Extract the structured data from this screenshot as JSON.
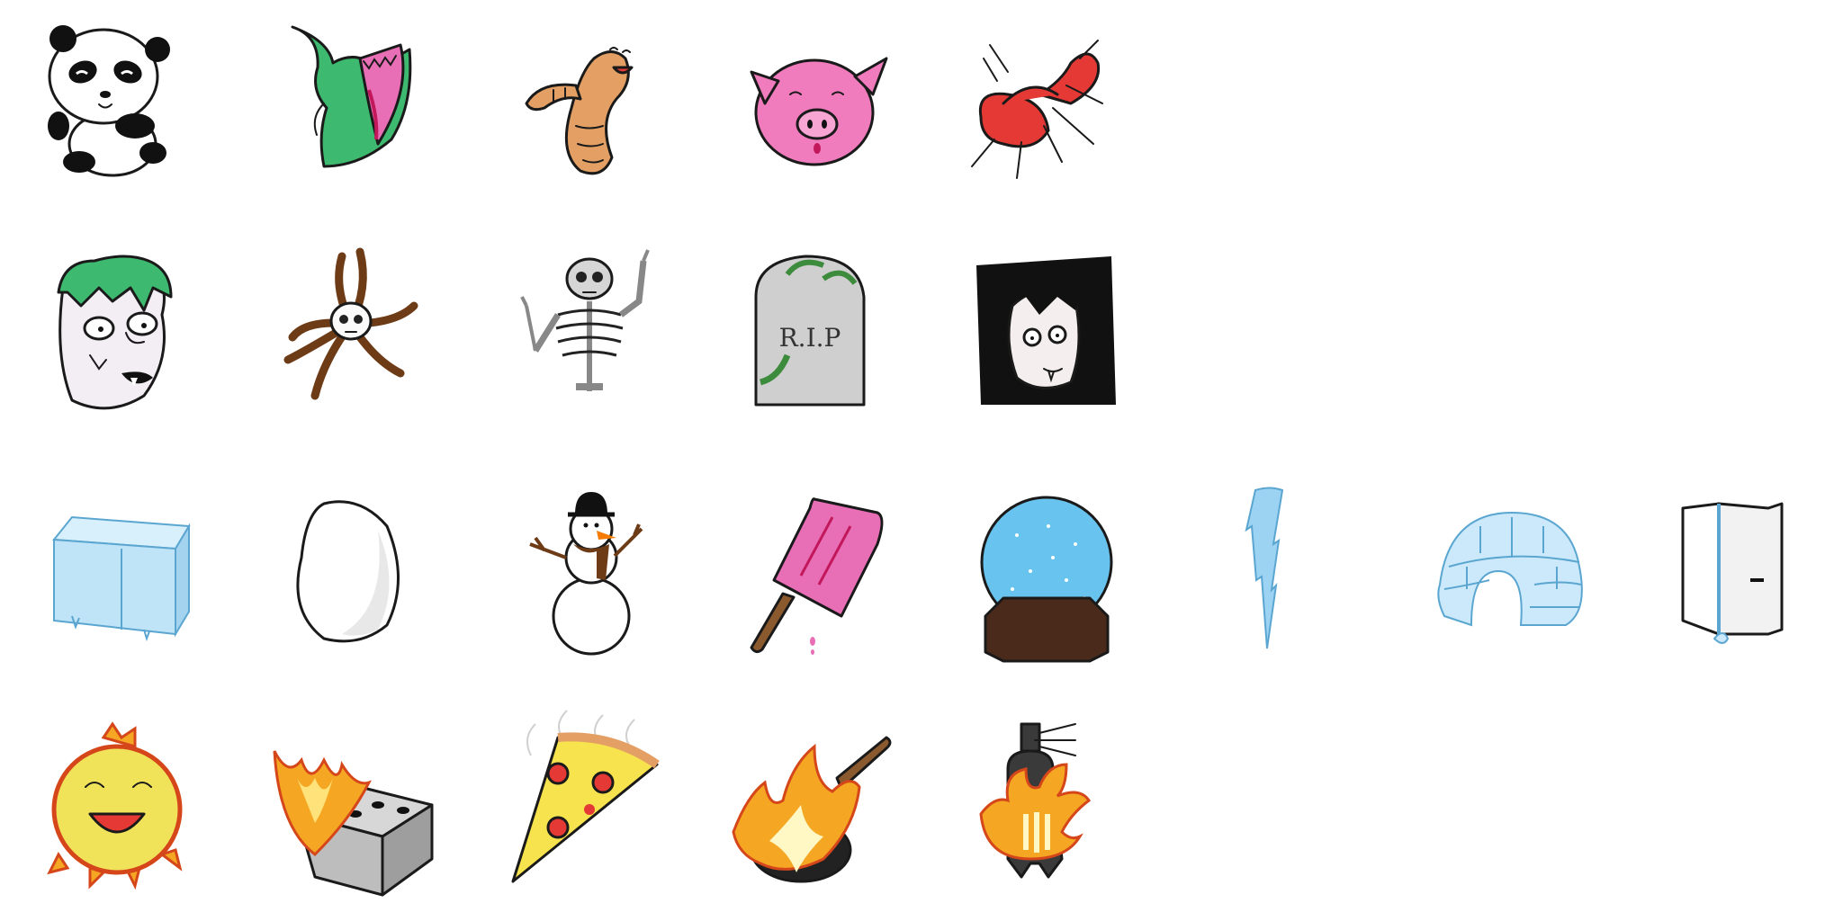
{
  "sheet": {
    "rows": [
      {
        "theme": "animals",
        "sprites": [
          {
            "icon": "panda-icon"
          },
          {
            "icon": "crocodile-icon"
          },
          {
            "icon": "worm-icon"
          },
          {
            "icon": "pig-icon"
          },
          {
            "icon": "ant-icon"
          }
        ]
      },
      {
        "theme": "spooky",
        "sprites": [
          {
            "icon": "zombie-head-icon"
          },
          {
            "icon": "skull-vines-icon"
          },
          {
            "icon": "skeleton-icon"
          },
          {
            "icon": "gravestone-icon",
            "text": "R.I.P"
          },
          {
            "icon": "vampire-icon"
          }
        ]
      },
      {
        "theme": "cold",
        "sprites": [
          {
            "icon": "ice-block-icon"
          },
          {
            "icon": "snowball-icon"
          },
          {
            "icon": "snowman-icon"
          },
          {
            "icon": "popsicle-icon"
          },
          {
            "icon": "snow-globe-icon"
          },
          {
            "icon": "icicle-icon"
          },
          {
            "icon": "igloo-icon"
          },
          {
            "icon": "fridge-icon"
          }
        ]
      },
      {
        "theme": "hot",
        "sprites": [
          {
            "icon": "sun-icon"
          },
          {
            "icon": "burning-stove-icon"
          },
          {
            "icon": "pizza-slice-icon"
          },
          {
            "icon": "flaming-pan-icon"
          },
          {
            "icon": "wood-stove-fire-icon"
          }
        ]
      }
    ],
    "colors": {
      "background": "#ffffff",
      "ink": "#1a1a1a",
      "ice": "#bfe3f7",
      "fire": "#f5a623",
      "pink": "#e86fb6",
      "green": "#3dba6f"
    }
  }
}
